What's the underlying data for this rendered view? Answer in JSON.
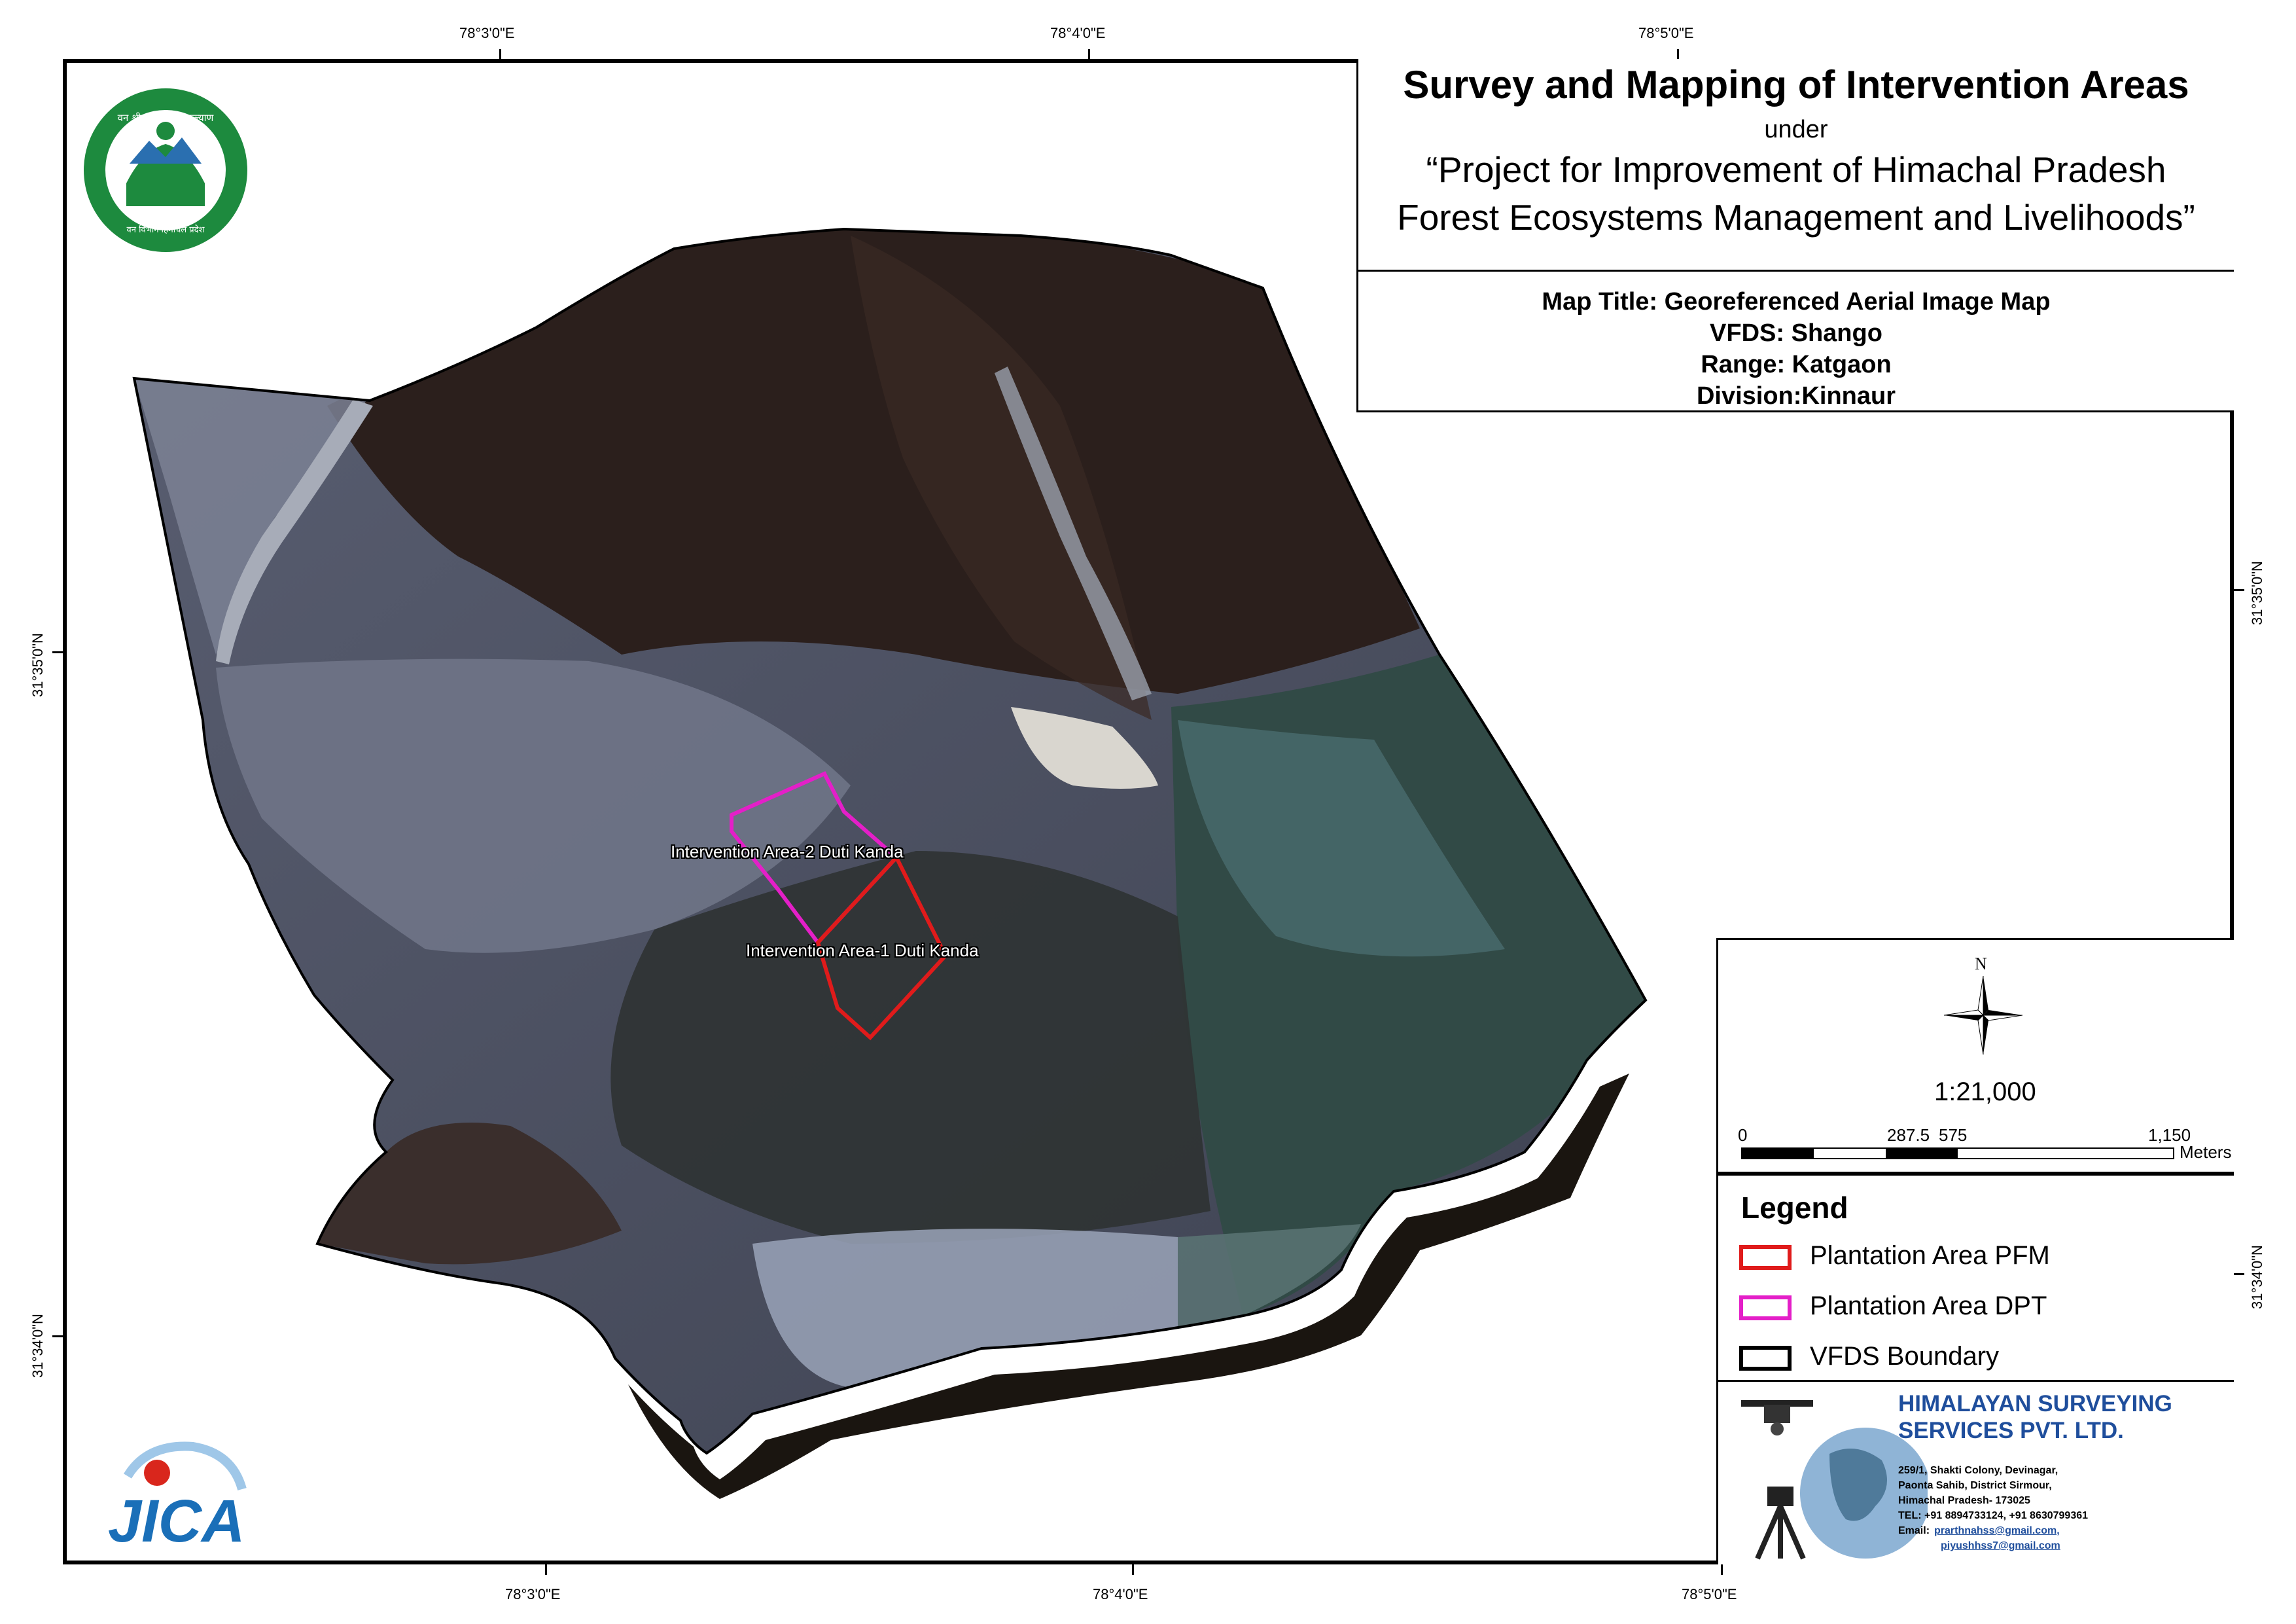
{
  "title": {
    "main": "Survey and Mapping of Intervention Areas",
    "under": "under",
    "project_line1": "“Project for Improvement of Himachal Pradesh",
    "project_line2": "Forest Ecosystems Management and Livelihoods”"
  },
  "map_info": {
    "map_title": "Map Title: Georeferenced Aerial Image Map",
    "vfds": "VFDS: Shango",
    "range": "Range: Katgaon",
    "division": "Division:Kinnaur"
  },
  "coordinates": {
    "top": [
      "78°3'0\"E",
      "78°4'0\"E",
      "78°5'0\"E"
    ],
    "bottom": [
      "78°3'0\"E",
      "78°4'0\"E",
      "78°5'0\"E"
    ],
    "left": [
      "31°35'0\"N",
      "31°34'0\"N"
    ],
    "right": [
      "31°35'0\"N",
      "31°34'0\"N"
    ]
  },
  "map_labels": {
    "area2": "Intervention Area-2 Duti Kanda",
    "area1": "Intervention Area-1 Duti Kanda"
  },
  "north": {
    "letter": "N",
    "scale": "1:21,000",
    "scalebar_ticks": [
      "0",
      "287.5",
      "575",
      "1,150"
    ],
    "scalebar_unit": "Meters"
  },
  "legend": {
    "title": "Legend",
    "items": [
      {
        "label": "Plantation Area PFM",
        "color": "#e01b1b"
      },
      {
        "label": "Plantation Area DPT",
        "color": "#e41fc8"
      },
      {
        "label": "VFDS Boundary",
        "color": "#000000"
      }
    ]
  },
  "company": {
    "name_line1": "HIMALAYAN SURVEYING",
    "name_line2": "SERVICES PVT. LTD.",
    "address1": "259/1, Shakti Colony, Devinagar,",
    "address2": "Paonta Sahib, District Sirmour,",
    "address3": "Himachal Pradesh- 173025",
    "tel": "TEL: +91 8894733124, +91 8630799361",
    "email_label": "Email:",
    "email1": "prarthnahss@gmail.com,",
    "email2": "piyushhss7@gmail.com"
  },
  "logos": {
    "forest_dept_seal_text_top": "वन श्री त्राण, विश्व कल्याण",
    "forest_dept_seal_text_bottom": "वन विभाग हिमाचल प्रदेश",
    "jica": "JICA"
  },
  "colors": {
    "pfm": "#e01b1b",
    "dpt": "#e41fc8",
    "company_blue": "#1f4e9c",
    "seal_green": "#1d8a3e",
    "jica_blue": "#1a6fb8"
  }
}
